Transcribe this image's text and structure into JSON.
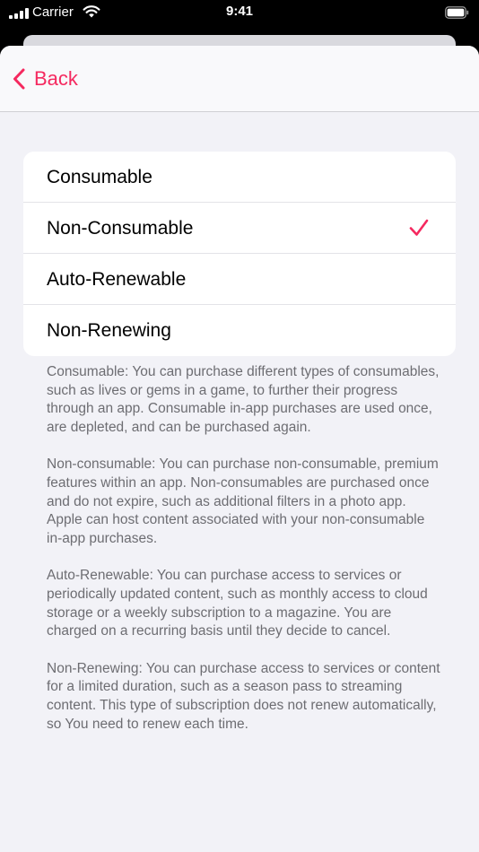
{
  "status_bar": {
    "carrier": "Carrier",
    "time": "9:41",
    "icons": [
      "cellular-signal-icon",
      "wifi-icon",
      "battery-icon"
    ]
  },
  "nav": {
    "back_label": "Back",
    "back_icon": "chevron-left-icon"
  },
  "options": {
    "items": [
      {
        "label": "Consumable",
        "selected": false
      },
      {
        "label": "Non-Consumable",
        "selected": true
      },
      {
        "label": "Auto-Renewable",
        "selected": false
      },
      {
        "label": "Non-Renewing",
        "selected": false
      }
    ]
  },
  "descriptions": {
    "consumable": "Consumable: You can purchase different types of consumables, such as lives or gems in a game, to further their progress through an app. Consumable in-app purchases are used once, are depleted, and can be purchased again.",
    "non_consumable": "Non-consumable: You can purchase non-consumable, premium features within an app. Non-consumables are purchased once and do not expire, such as additional filters in a photo app. Apple can host content associated with your non-consumable in-app purchases.",
    "auto_renewable": "Auto-Renewable: You can purchase access to services or periodically updated content, such as monthly access to cloud storage or a weekly subscription to a magazine. You are charged on a recurring basis until they decide to cancel.",
    "non_renewing": "Non-Renewing: You can purchase access to services or content for a limited duration, such as a season pass to streaming content. This type of subscription does not renew automatically, so You need to renew each time."
  },
  "colors": {
    "accent": "#f5295f",
    "background": "#f2f2f7",
    "card": "#ffffff",
    "secondary_text": "#6d6d72"
  }
}
